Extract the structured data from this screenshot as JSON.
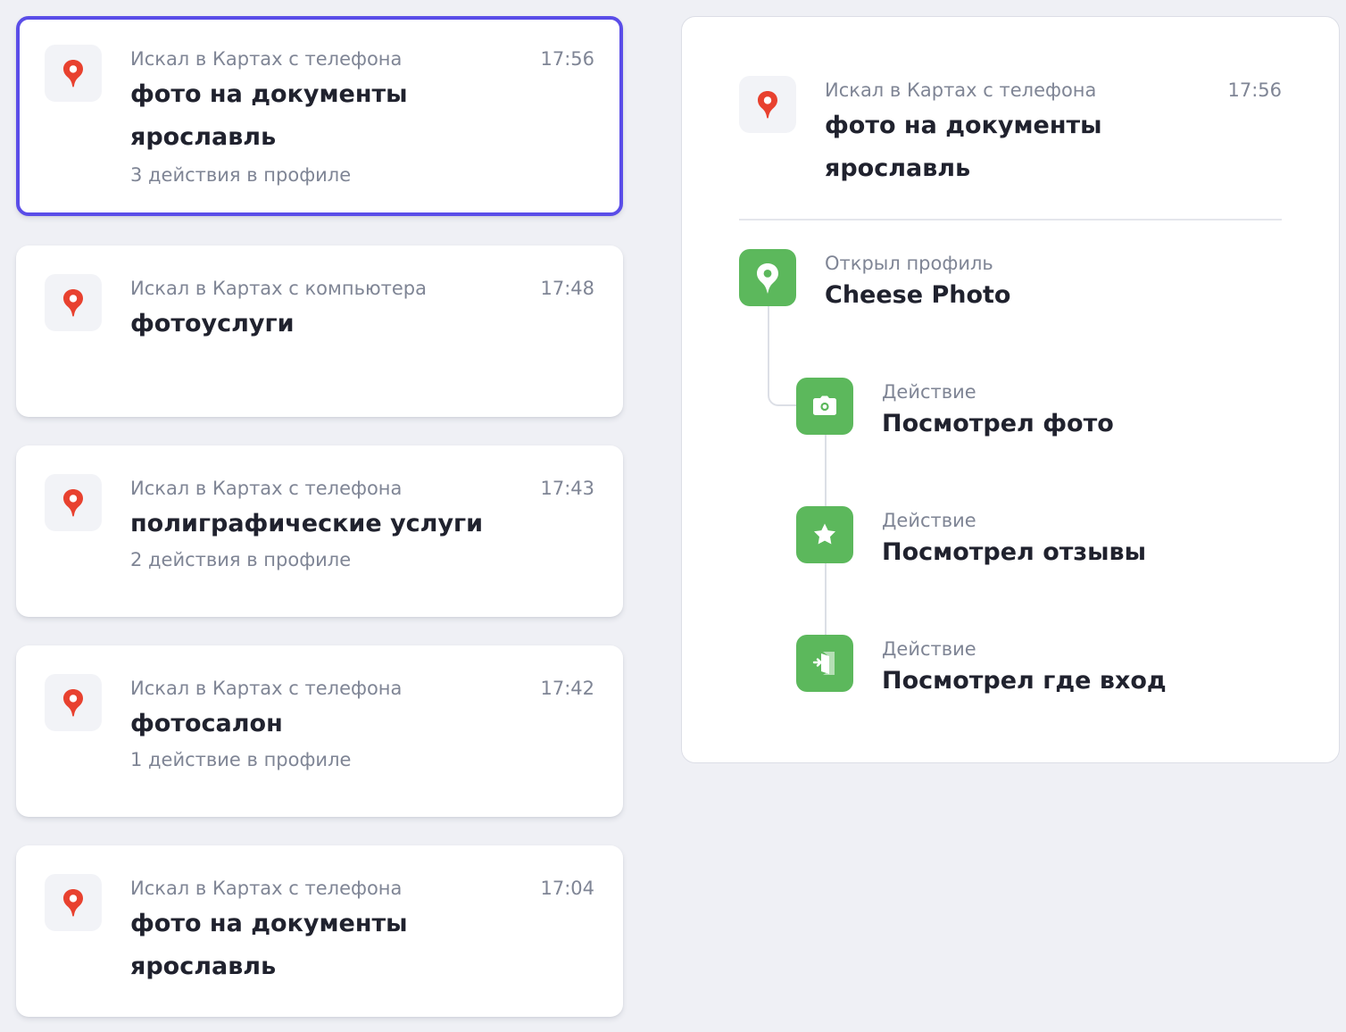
{
  "searches": [
    {
      "source": "Искал в Картах с телефона",
      "time": "17:56",
      "query": "фото на документы ярославль",
      "actions": "3 действия в профиле",
      "selected": true
    },
    {
      "source": "Искал в Картах с компьютера",
      "time": "17:48",
      "query": "фотоуслуги",
      "actions": "",
      "selected": false
    },
    {
      "source": "Искал в Картах с телефона",
      "time": "17:43",
      "query": "полиграфические услуги",
      "actions": "2 действия в профиле",
      "selected": false
    },
    {
      "source": "Искал в Картах с телефона",
      "time": "17:42",
      "query": "фотосалон",
      "actions": "1 действие в профиле",
      "selected": false
    },
    {
      "source": "Искал в Картах с телефона",
      "time": "17:04",
      "query": "фото на документы ярославль",
      "actions": "",
      "selected": false
    }
  ],
  "detail": {
    "source": "Искал в Картах с телефона",
    "time": "17:56",
    "query": "фото на документы ярославль",
    "profile": {
      "label": "Открыл профиль",
      "name": "Cheese Photo",
      "icon": "location-pin-icon"
    },
    "actions": [
      {
        "label": "Действие",
        "title": "Посмотрел фото",
        "icon": "camera-icon"
      },
      {
        "label": "Действие",
        "title": "Посмотрел отзывы",
        "icon": "star-icon"
      },
      {
        "label": "Действие",
        "title": "Посмотрел где вход",
        "icon": "entrance-icon"
      }
    ]
  },
  "colors": {
    "background": "#eff0f5",
    "selected_border": "#5a4de8",
    "action_green": "#5cb85c",
    "maps_pin_red": "#e8412f",
    "muted_text": "#7f8595",
    "primary_text": "#20222e"
  }
}
